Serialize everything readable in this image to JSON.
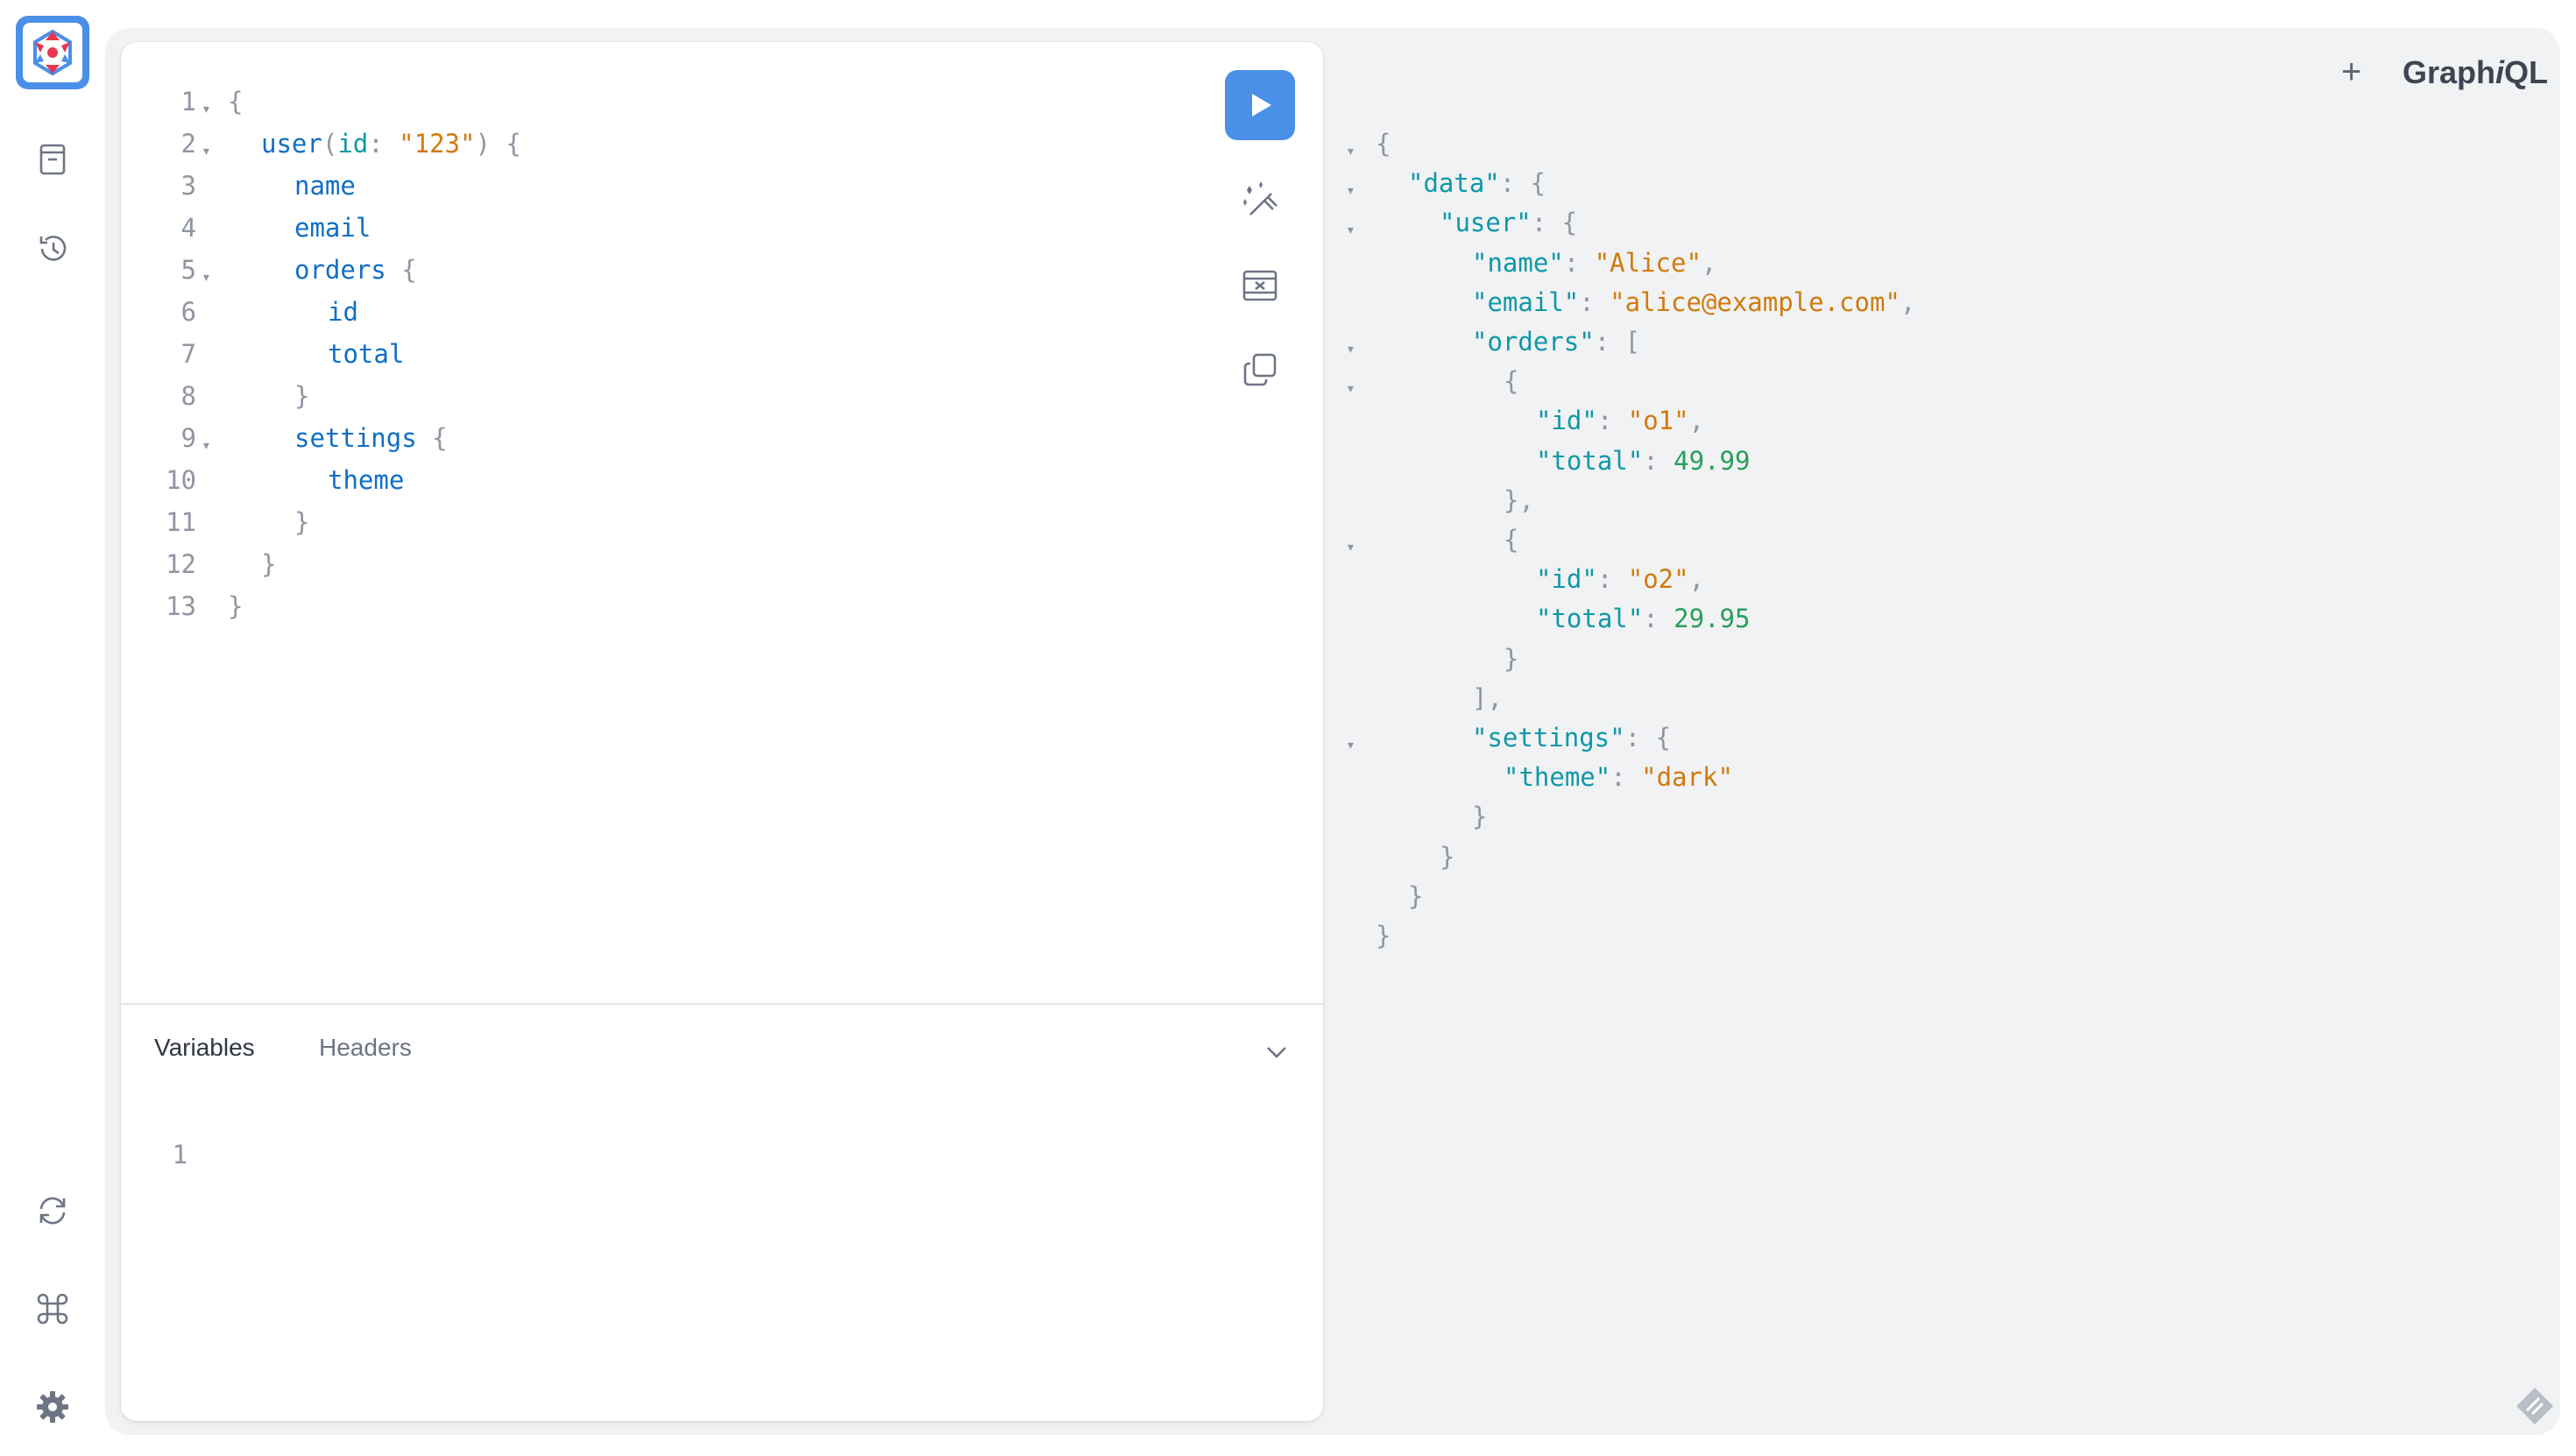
{
  "sidebar": {
    "logo": "graphiql-logo",
    "top_buttons": [
      "documentation-icon",
      "history-icon"
    ],
    "bottom_buttons": [
      "refetch-schema-icon",
      "shortcuts-icon",
      "settings-icon"
    ]
  },
  "header": {
    "add_tab_label": "+",
    "brand_prefix": "Graph",
    "brand_italic": "i",
    "brand_suffix": "QL"
  },
  "query_editor": {
    "line_numbers": [
      "1",
      "2",
      "3",
      "4",
      "5",
      "6",
      "7",
      "8",
      "9",
      "10",
      "11",
      "12",
      "13"
    ],
    "lines": [
      {
        "text_open": "{"
      },
      {
        "field": "user",
        "paren_open": "(",
        "arg": "id",
        "colon": ": ",
        "value": "\"123\"",
        "paren_close": ")",
        "brace": " {"
      },
      {
        "field": "name"
      },
      {
        "field": "email"
      },
      {
        "field": "orders",
        "brace": " {"
      },
      {
        "field": "id"
      },
      {
        "field": "total"
      },
      {
        "close": "}"
      },
      {
        "field": "settings",
        "brace": " {"
      },
      {
        "field": "theme"
      },
      {
        "close": "}"
      },
      {
        "close": "}"
      },
      {
        "close": "}"
      }
    ]
  },
  "toolbar": {
    "execute": "execute-icon",
    "prettify": "prettify-icon",
    "merge": "merge-fragments-icon",
    "copy": "copy-icon"
  },
  "variables_panel": {
    "tabs": [
      "Variables",
      "Headers"
    ],
    "line_number": "1"
  },
  "result": {
    "lines": [
      {
        "open": "{"
      },
      {
        "key": "\"data\"",
        "after": ": {"
      },
      {
        "key": "\"user\"",
        "after": ": {"
      },
      {
        "key": "\"name\"",
        "sep": ": ",
        "str": "\"Alice\"",
        "tail": ","
      },
      {
        "key": "\"email\"",
        "sep": ": ",
        "str": "\"alice@example.com\"",
        "tail": ","
      },
      {
        "key": "\"orders\"",
        "after": ": ["
      },
      {
        "open": "{"
      },
      {
        "key": "\"id\"",
        "sep": ": ",
        "str": "\"o1\"",
        "tail": ","
      },
      {
        "key": "\"total\"",
        "sep": ": ",
        "num": "49.99"
      },
      {
        "close": "},"
      },
      {
        "open": "{"
      },
      {
        "key": "\"id\"",
        "sep": ": ",
        "str": "\"o2\"",
        "tail": ","
      },
      {
        "key": "\"total\"",
        "sep": ": ",
        "num": "29.95"
      },
      {
        "close": "}"
      },
      {
        "close": "],"
      },
      {
        "key": "\"settings\"",
        "after": ": {"
      },
      {
        "key": "\"theme\"",
        "sep": ": ",
        "str": "\"dark\""
      },
      {
        "close": "}"
      },
      {
        "close": "}"
      },
      {
        "close": "}"
      },
      {
        "close": "}"
      }
    ]
  },
  "colors": {
    "accent": "#4a8fe8",
    "field": "#0f6ec6",
    "key": "#0d98a8",
    "string": "#d17a0c",
    "number": "#27a05a",
    "punctuation": "#8f96a2"
  }
}
